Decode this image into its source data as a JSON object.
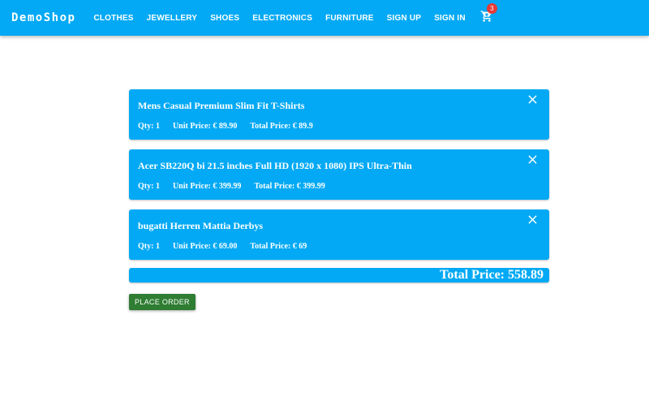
{
  "header": {
    "brand": "DemoShop",
    "nav": [
      "CLOTHES",
      "JEWELLERY",
      "SHOES",
      "ELECTRONICS",
      "FURNITURE",
      "SIGN UP",
      "SIGN IN"
    ],
    "cart_icon": "cart-icon",
    "cart_count": "3"
  },
  "cart": {
    "items": [
      {
        "name": "Mens Casual Premium Slim Fit T-Shirts",
        "qty": "Qty: 1",
        "unit_price": "Unit Price: € 89.90",
        "total_price": "Total Price: € 89.9"
      },
      {
        "name": "Acer SB220Q bi 21.5 inches Full HD (1920 x 1080) IPS Ultra-Thin",
        "qty": "Qty: 1",
        "unit_price": "Unit Price: € 399.99",
        "total_price": "Total Price: € 399.99"
      },
      {
        "name": "bugatti Herren Mattia Derbys",
        "qty": "Qty: 1",
        "unit_price": "Unit Price: € 69.00",
        "total_price": "Total Price: € 69"
      }
    ],
    "close_icon": "close-icon",
    "total": "Total Price: 558.89",
    "place_order_label": "PLACE ORDER"
  },
  "colors": {
    "primary": "#03a9f4",
    "success": "#2e7d32",
    "badge": "#e53935"
  }
}
